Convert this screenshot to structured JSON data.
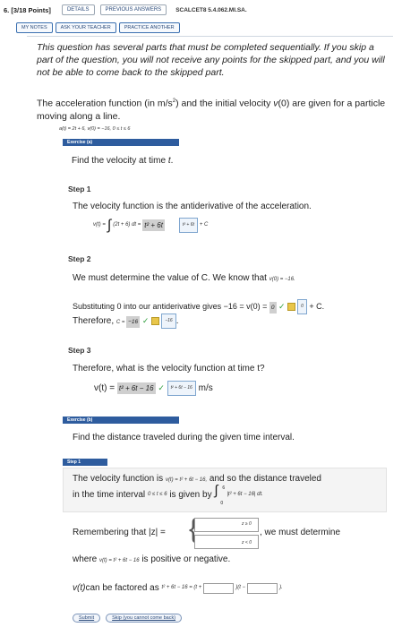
{
  "header": {
    "question_number": "6. [3/18 Points]",
    "details_label": "DETAILS",
    "previous_answers_label": "PREVIOUS ANSWERS",
    "code": "SCALCET8 5.4.062.MI.SA."
  },
  "toolbar": {
    "my_notes_label": "MY NOTES",
    "ask_teacher_label": "ASK YOUR TEACHER",
    "practice_label": "PRACTICE ANOTHER"
  },
  "notice": "This question has several parts that must be completed sequentially. If you skip a part of the question, you will not receive any points for the skipped part, and you will not be able to come back to the skipped part.",
  "problem": {
    "text_a": "The acceleration function (in m/s",
    "text_sup": "2",
    "text_b": ") and the initial velocity ",
    "text_var": "v",
    "text_c": "(0) are given for a particle moving along a line.",
    "given": "a(t) = 2t + 6,   v(0) = −16,   0 ≤ t ≤ 6"
  },
  "exercise_a": {
    "bar_label": "Exercise (a)",
    "prompt_a": "Find the velocity at time ",
    "prompt_var": "t",
    "prompt_b": ".",
    "step1": {
      "label": "Step 1",
      "text": "The velocity function is the antiderivative of the acceleration.",
      "lhs": "v(t) = ",
      "integral_sign": "∫",
      "integrand": "(2t + 6) dt = ",
      "entered": "t² + 6t",
      "answer": "t² + 6t",
      "plus_c": "+ C"
    },
    "step2": {
      "label": "Step 2",
      "text": "We must determine the value of C. We know that ",
      "known": "v(0) = −16.",
      "sub_text": "Substituting 0 into our antiderivative gives −16 = v(0) = ",
      "entered_zero": "0",
      "answer_zero": "0",
      "plus_c": "+ C.",
      "therefore": "Therefore, ",
      "c_lhs": "C = ",
      "entered_c": "−16",
      "answer_c": "−16",
      "period": "."
    },
    "step3": {
      "label": "Step 3",
      "text": "Therefore, what is the velocity function at time t?",
      "lhs": "v(t) = ",
      "entered": "t² + 6t − 16",
      "answer": "t² + 6t − 16",
      "units": "m/s"
    }
  },
  "exercise_b": {
    "bar_label": "Exercise (b)",
    "prompt": "Find the distance traveled during the given time interval.",
    "step1": {
      "bar_label": "Step 1",
      "text_a": "The velocity function is ",
      "vel": "v(t) = t² + 6t − 16,",
      "text_b": " and so the distance traveled",
      "text_c": "in the time interval ",
      "interval": "0 ≤ t ≤ 6",
      "text_d": " is given by ",
      "integral_sign": "∫",
      "lower": "0",
      "upper": "6",
      "integrand": "|t² + 6t − 16| dt.",
      "remember": "Remembering that |z| = ",
      "case1": "z ≥ 0",
      "case2": "z < 0",
      "we_must": ", we must determine",
      "where": "where ",
      "where_vel": "v(t) = t² + 6t − 16",
      "pos_neg": " is positive or negative.",
      "factored_a": "v(t)",
      "factored_b": " can be factored as ",
      "factored_expr": "t² + 6t − 16 = (t +",
      "factored_mid": ")(t −",
      "factored_end": ")."
    },
    "submit_label": "Submit",
    "skip_label": "Skip (you cannot come back)"
  }
}
